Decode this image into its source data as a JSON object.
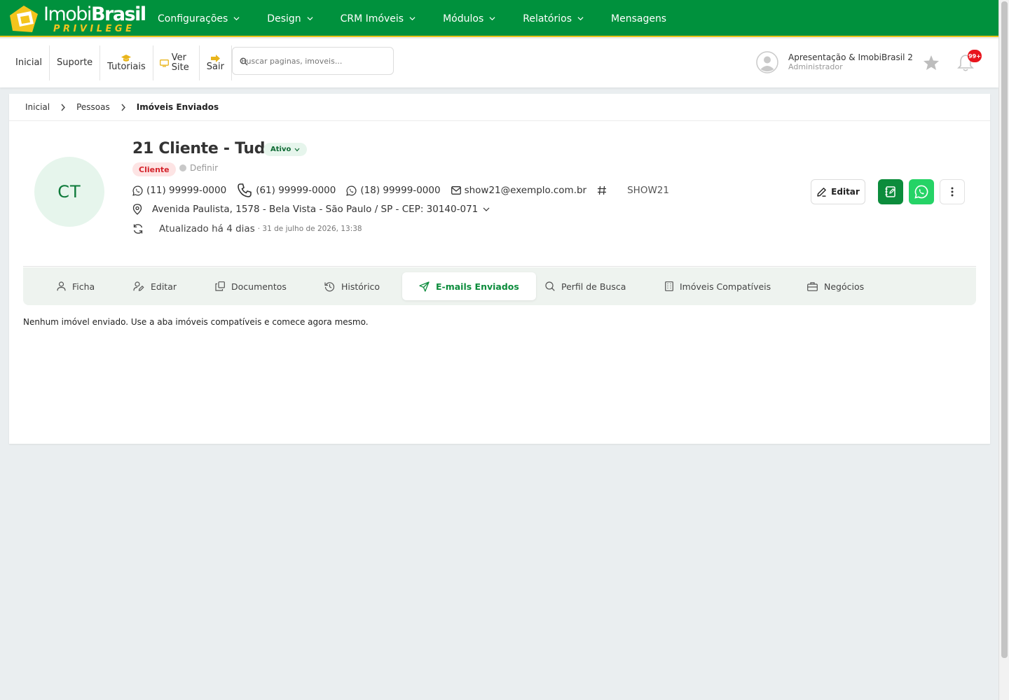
{
  "brand": {
    "name_light": "Imobi",
    "name_bold": "Brasil",
    "tagline": "PRIVILEGE",
    "colors": {
      "primary": "#00913d",
      "accent": "#e9c21a"
    }
  },
  "topnav": {
    "items": [
      {
        "label": "Configurações",
        "dropdown": true
      },
      {
        "label": "Design",
        "dropdown": true
      },
      {
        "label": "CRM Imóveis",
        "dropdown": true
      },
      {
        "label": "Módulos",
        "dropdown": true
      },
      {
        "label": "Relatórios",
        "dropdown": true
      },
      {
        "label": "Mensagens",
        "dropdown": false
      }
    ]
  },
  "subbar": {
    "links": [
      {
        "label": "Inicial",
        "icon": ""
      },
      {
        "label": "Suporte",
        "icon": ""
      },
      {
        "label": "Tutoriais",
        "icon": "graduation-cap-icon"
      },
      {
        "label": "Ver Site",
        "icon": "monitor-icon"
      },
      {
        "label": "Sair",
        "icon": "sign-out-icon"
      }
    ],
    "search_placeholder": "Buscar paginas, imoveis...",
    "user": {
      "name": "Apresentação & ImobiBrasil 2",
      "role": "Administrador"
    },
    "notifications_badge": "99+"
  },
  "breadcrumb": [
    "Inicial",
    "Pessoas",
    "Imóveis Enviados"
  ],
  "person": {
    "initials": "CT",
    "name": "21 Cliente - Tudo",
    "status": "Ativo",
    "tag": "Cliente",
    "define_label": "Definir",
    "phones": [
      {
        "type": "whatsapp",
        "value": "(11) 99999-0000"
      },
      {
        "type": "phone",
        "value": "(61) 99999-0000"
      },
      {
        "type": "whatsapp",
        "value": "(18) 99999-0000"
      }
    ],
    "email": "show21@exemplo.com.br",
    "code": "SHOW21",
    "address": "Avenida Paulista, 1578 - Bela Vista - São Paulo / SP - CEP: 30140-071",
    "updated": "Atualizado há 4 dias",
    "updated_date": "· 31 de julho de 2026, 13:38"
  },
  "actions": {
    "edit_label": "Editar"
  },
  "tabs": [
    {
      "label": "Ficha",
      "icon": "user-icon",
      "active": false
    },
    {
      "label": "Editar",
      "icon": "user-edit-icon",
      "active": false
    },
    {
      "label": "Documentos",
      "icon": "documents-icon",
      "active": false
    },
    {
      "label": "Histórico",
      "icon": "history-icon",
      "active": false
    },
    {
      "label": "E-mails Enviados",
      "icon": "send-icon",
      "active": true
    },
    {
      "label": "Perfil de Busca",
      "icon": "search-icon",
      "active": false
    },
    {
      "label": "Imóveis Compatíveis",
      "icon": "building-icon",
      "active": false
    },
    {
      "label": "Negócios",
      "icon": "briefcase-icon",
      "active": false
    }
  ],
  "empty_message": "Nenhum imóvel enviado. Use a aba imóveis compatíveis e comece agora mesmo."
}
